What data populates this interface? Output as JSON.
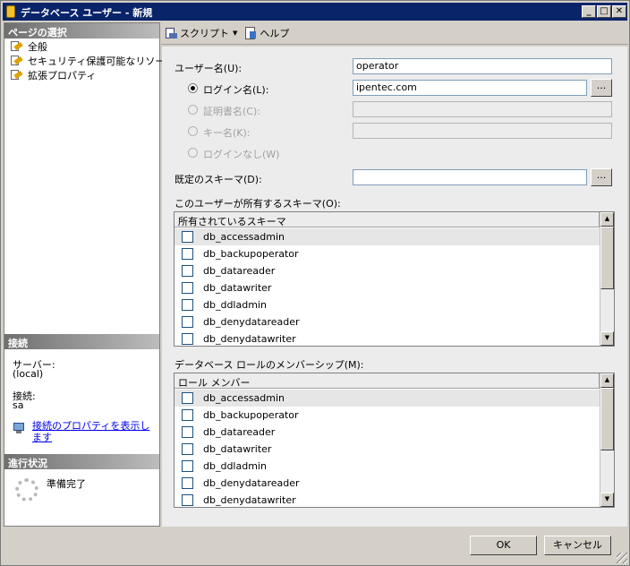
{
  "window": {
    "title": "データベース ユーザー - 新規",
    "min_glyph": "_",
    "max_glyph": "□",
    "close_glyph": "✕"
  },
  "sidebar": {
    "pages_header": "ページの選択",
    "pages": [
      {
        "label": "全般",
        "icon": "page-wrench-icon"
      },
      {
        "label": "セキュリティ保護可能なリソース",
        "icon": "page-wrench-icon"
      },
      {
        "label": "拡張プロパティ",
        "icon": "page-wrench-icon"
      }
    ],
    "connection_header": "接続",
    "server_label": "サーバー:",
    "server_value": "(local)",
    "connection_label": "接続:",
    "connection_value": "sa",
    "view_props_link": "接続のプロパティを表示します",
    "progress_header": "進行状況",
    "progress_status": "準備完了"
  },
  "toolbar": {
    "script_label": "スクリプト",
    "script_caret": "▼",
    "help_label": "ヘルプ"
  },
  "form": {
    "username_label": "ユーザー名(U):",
    "username_value": "operator",
    "login_label": "ログイン名(L):",
    "login_value": "ipentec.com",
    "cert_label": "証明書名(C):",
    "key_label": "キー名(K):",
    "no_login_label": "ログインなし(W)",
    "default_schema_label": "既定のスキーマ(D):",
    "default_schema_value": "",
    "browse_label": "..."
  },
  "owned_schemas": {
    "section_label": "このユーザーが所有するスキーマ(O):",
    "column_header": "所有されているスキーマ",
    "rows": [
      "db_accessadmin",
      "db_backupoperator",
      "db_datareader",
      "db_datawriter",
      "db_ddladmin",
      "db_denydatareader",
      "db_denydatawriter"
    ]
  },
  "role_membership": {
    "section_label": "データベース ロールのメンバーシップ(M):",
    "column_header": "ロール メンバー",
    "rows": [
      "db_accessadmin",
      "db_backupoperator",
      "db_datareader",
      "db_datawriter",
      "db_ddladmin",
      "db_denydatareader",
      "db_denydatawriter"
    ]
  },
  "scroll": {
    "up": "▲",
    "down": "▼"
  },
  "buttons": {
    "ok": "OK",
    "cancel": "キャンセル"
  },
  "colors": {
    "titlebar": "#0a246a",
    "section_header": "#808080",
    "link": "#0000ee",
    "dialog": "#d4d0c8"
  }
}
